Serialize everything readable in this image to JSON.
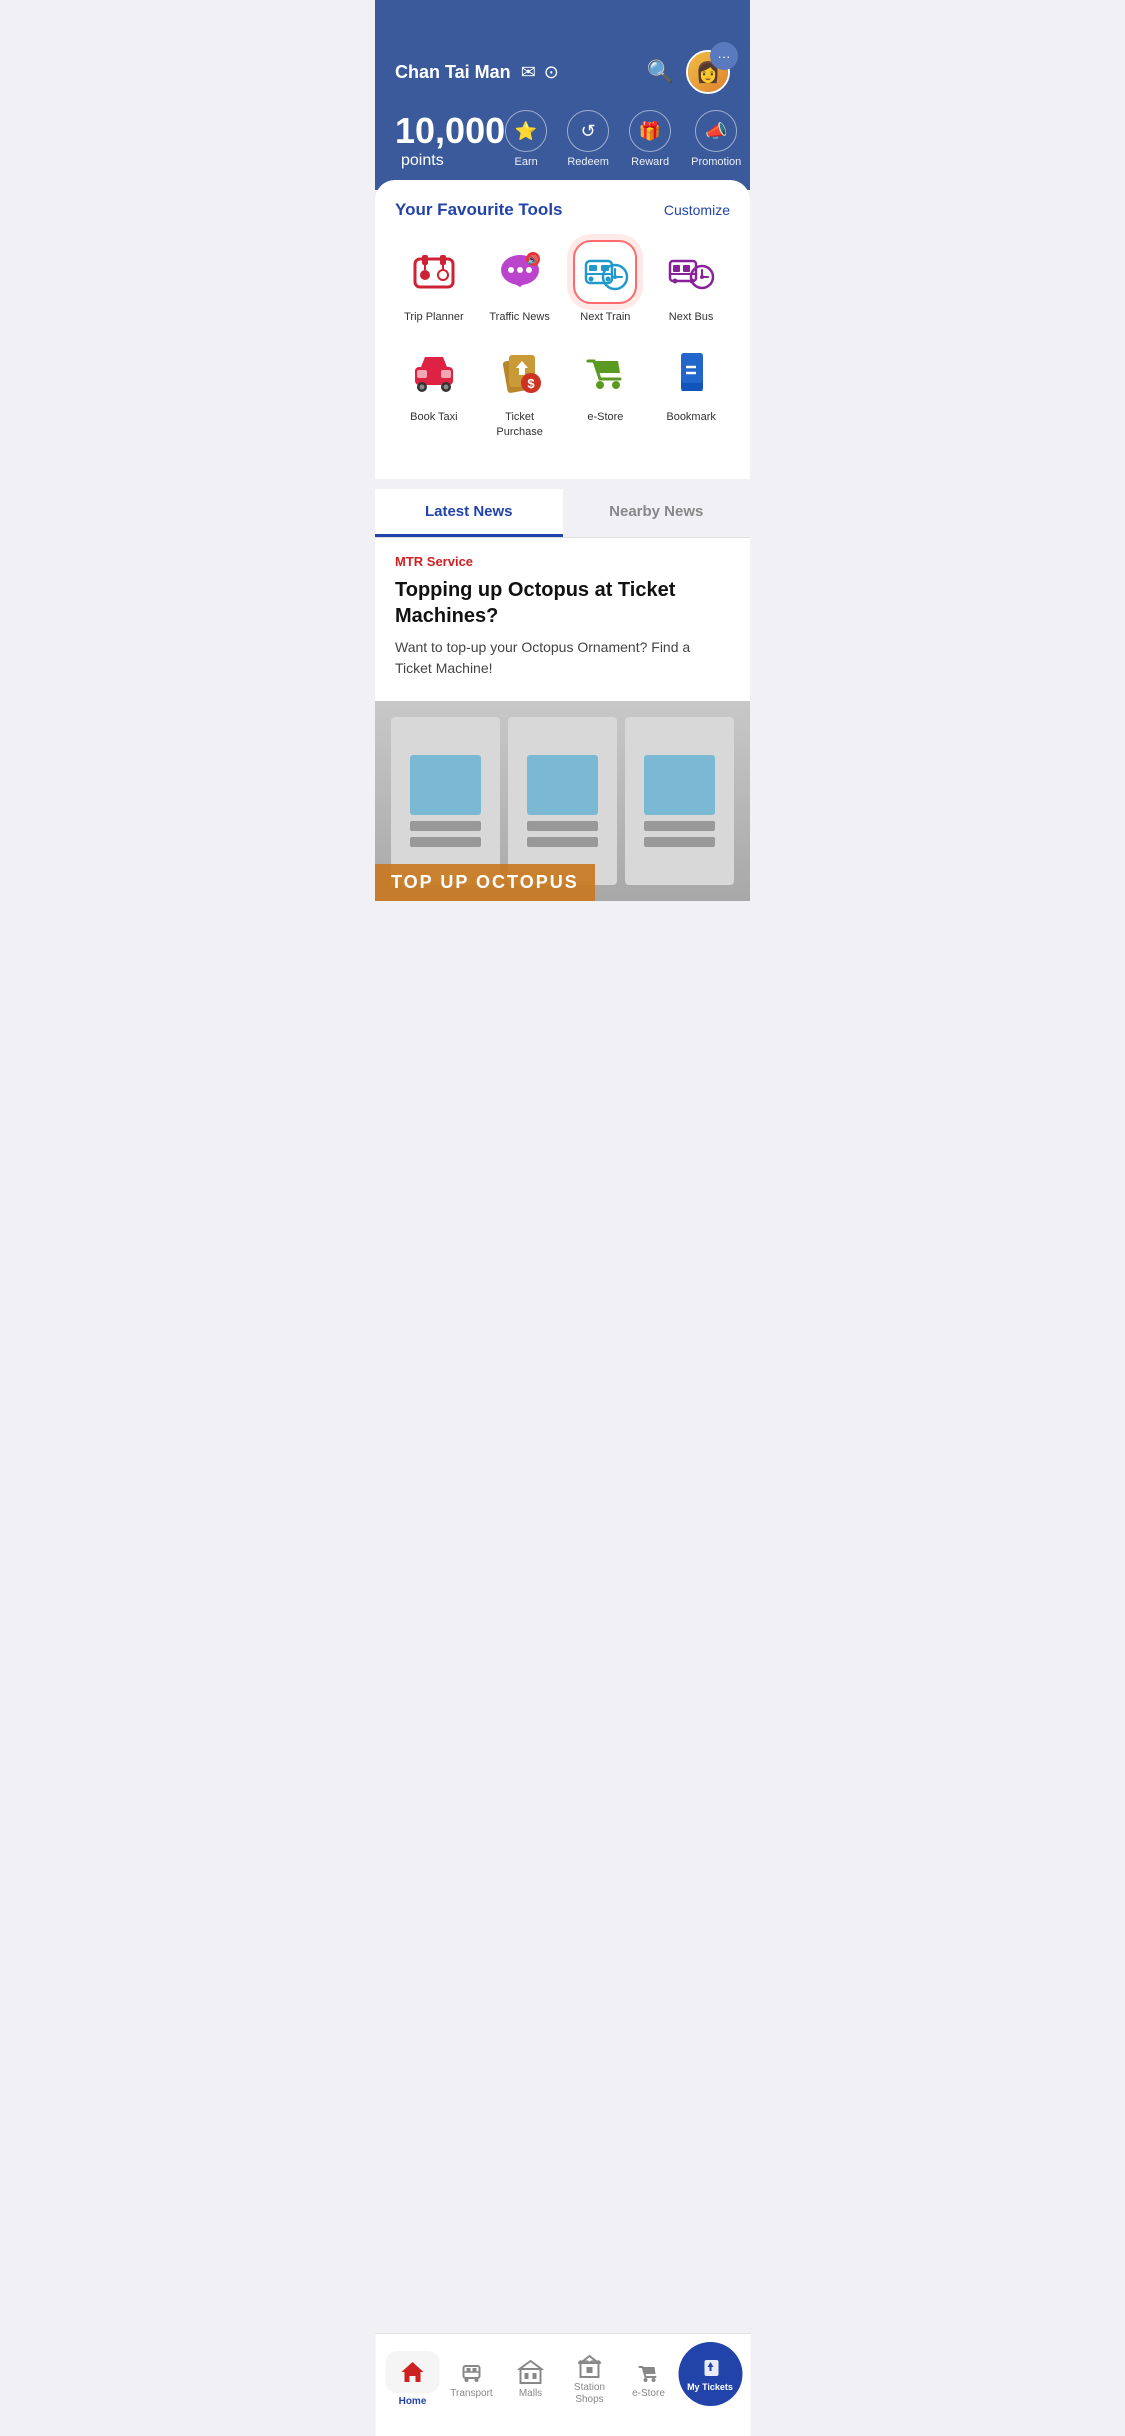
{
  "header": {
    "user_name": "Chan Tai Man",
    "points_value": "10,000",
    "points_label": "points"
  },
  "quick_actions": [
    {
      "id": "earn",
      "label": "Earn",
      "icon": "⭐"
    },
    {
      "id": "redeem",
      "label": "Redeem",
      "icon": "🔄"
    },
    {
      "id": "reward",
      "label": "Reward",
      "icon": "🎁"
    },
    {
      "id": "promotion",
      "label": "Promotion",
      "icon": "📣"
    }
  ],
  "tools_section": {
    "title": "Your Favourite Tools",
    "customize_label": "Customize"
  },
  "tools": [
    {
      "id": "trip-planner",
      "label": "Trip Planner",
      "highlighted": false
    },
    {
      "id": "traffic-news",
      "label": "Traffic News",
      "highlighted": false
    },
    {
      "id": "next-train",
      "label": "Next Train",
      "highlighted": true
    },
    {
      "id": "next-bus",
      "label": "Next Bus",
      "highlighted": false
    },
    {
      "id": "book-taxi",
      "label": "Book Taxi",
      "highlighted": false
    },
    {
      "id": "ticket-purchase",
      "label": "Ticket Purchase",
      "highlighted": false
    },
    {
      "id": "e-store",
      "label": "e-Store",
      "highlighted": false
    },
    {
      "id": "bookmark",
      "label": "Bookmark",
      "highlighted": false
    }
  ],
  "news": {
    "tab_latest": "Latest News",
    "tab_nearby": "Nearby News",
    "category": "MTR Service",
    "title": "Topping up Octopus at Ticket Machines?",
    "description": "Want to top-up your Octopus Ornament? Find a Ticket Machine!",
    "image_banner": "TOP UP OCTOPUS"
  },
  "bottom_nav": [
    {
      "id": "home",
      "label": "Home",
      "active": true
    },
    {
      "id": "transport",
      "label": "Transport",
      "active": false
    },
    {
      "id": "malls",
      "label": "Malls",
      "active": false
    },
    {
      "id": "station-shops",
      "label": "Station\nShops",
      "active": false
    },
    {
      "id": "e-store",
      "label": "e-Store",
      "active": false
    }
  ],
  "my_tickets": {
    "label": "My Tickets"
  }
}
